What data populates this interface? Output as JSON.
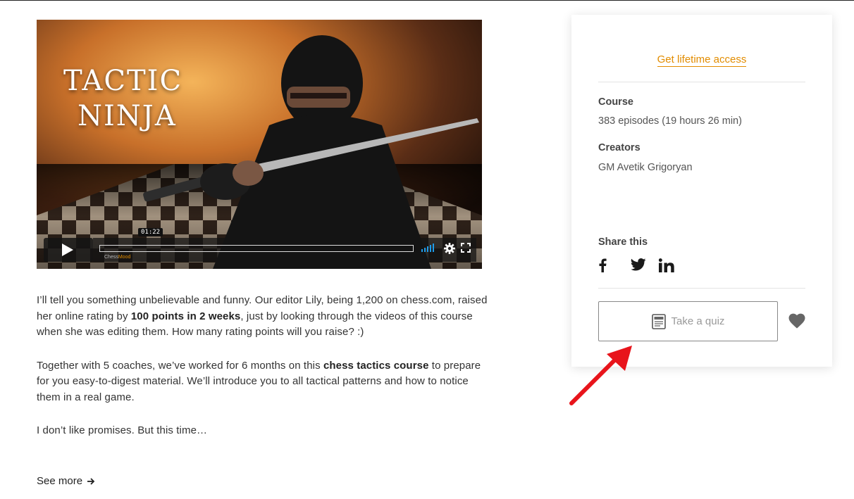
{
  "video": {
    "title_line1": "TACTIC",
    "title_line2": "NINJA",
    "time_tooltip": "01:22",
    "brand_prefix": "Chess",
    "brand_suffix": "Mood",
    "progress_fraction": 0
  },
  "description": {
    "p1_a": "I’ll tell you something unbelievable and funny. Our editor Lily, being 1,200 on chess.com, raised her online rating by ",
    "p1_bold": "100 points in 2 weeks",
    "p1_b": ", just by looking through the videos of this course when she was editing them. How many rating points will you raise? :)",
    "p2_a": "Together with 5 coaches, we’ve worked for 6 months on this ",
    "p2_bold": "chess tactics course",
    "p2_b": " to prepare for you easy-to-digest material. We’ll introduce you to all tactical patterns and how to notice them in a real game.",
    "p3": "I don’t like promises. But this time…",
    "see_more": "See more"
  },
  "card": {
    "access_link": "Get lifetime access",
    "course_label": "Course",
    "course_value": "383 episodes (19 hours 26 min)",
    "creators_label": "Creators",
    "creators_value": "GM Avetik Grigoryan",
    "share_label": "Share this",
    "social_icons": [
      "facebook-icon",
      "twitter-icon",
      "linkedin-icon"
    ],
    "quiz_button": "Take a quiz"
  },
  "colors": {
    "accent": "#e28c00",
    "annotation_arrow": "#e8141b"
  }
}
